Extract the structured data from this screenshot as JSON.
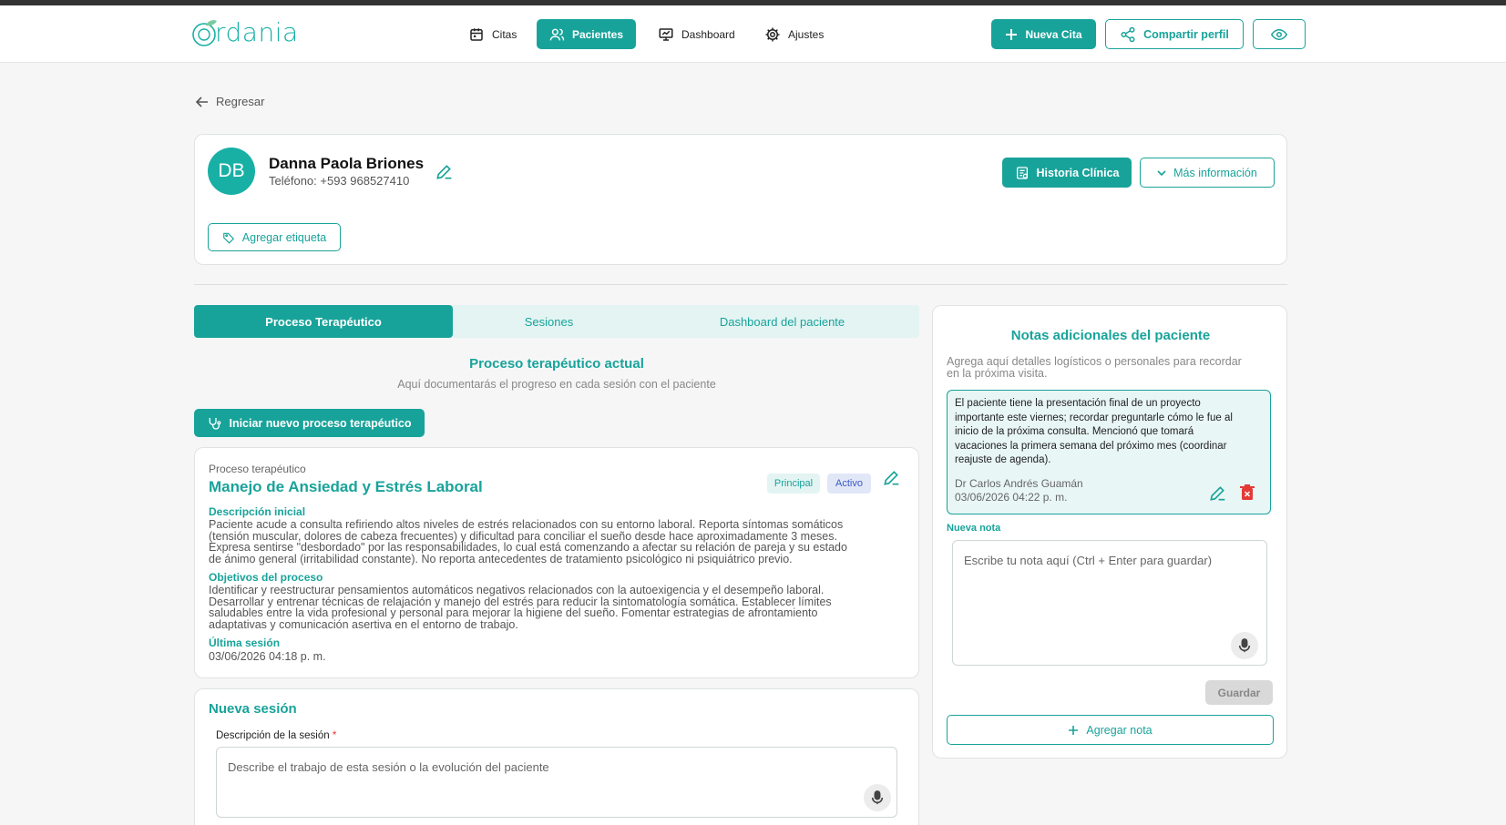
{
  "app": {
    "logo_text": "rdania"
  },
  "nav": {
    "citas": "Citas",
    "pacientes": "Pacientes",
    "dashboard": "Dashboard",
    "ajustes": "Ajustes",
    "nueva_cita": "Nueva Cita",
    "compartir_perfil": "Compartir perfil"
  },
  "back_label": "Regresar",
  "patient": {
    "initials": "DB",
    "name": "Danna Paola Briones",
    "phone": "Teléfono: +593 968527410",
    "historia_btn": "Historia Clínica",
    "mas_info_btn": "Más información",
    "tag_btn": "Agregar etiqueta"
  },
  "tabs": [
    "Proceso Terapéutico",
    "Sesiones",
    "Dashboard del paciente"
  ],
  "process_section": {
    "title": "Proceso terapéutico actual",
    "subtitle": "Aquí documentarás el progreso en cada sesión con el paciente",
    "new_btn": "Iniciar nuevo proceso terapéutico"
  },
  "process": {
    "kicker": "Proceso terapéutico",
    "title": "Manejo de Ansiedad y Estrés Laboral",
    "badge_principal": "Principal",
    "badge_activo": "Activo",
    "desc_label": "Descripción inicial",
    "desc_lines": [
      "Paciente acude a consulta refiriendo altos niveles de estrés relacionados con su entorno laboral. Reporta síntomas somáticos",
      "(tensión muscular, dolores de cabeza frecuentes) y dificultad para conciliar el sueño desde hace aproximadamente 3 meses.",
      "Expresa sentirse \"desbordado\" por las responsabilidades, lo cual está comenzando a afectar su relación de pareja y su estado",
      "de ánimo general (irritabilidad constante). No reporta antecedentes de tratamiento psicológico ni psiquiátrico previo."
    ],
    "goals_label": "Objetivos del proceso",
    "goals_lines": [
      "Identificar y reestructurar pensamientos automáticos negativos relacionados con la autoexigencia y el desempeño laboral.",
      "Desarrollar y entrenar técnicas de relajación y manejo del estrés para reducir la sintomatología somática. Establecer límites",
      "saludables entre la vida profesional y personal para mejorar la higiene del sueño. Fomentar estrategias de afrontamiento",
      "adaptativas y comunicación asertiva en el entorno de trabajo."
    ],
    "last_label": "Última sesión",
    "last_value": "03/06/2026 04:18 p. m."
  },
  "new_session": {
    "title": "Nueva sesión",
    "field_label": "Descripción de la sesión",
    "required_mark": "*",
    "placeholder": "Describe el trabajo de esta sesión o la evolución del paciente"
  },
  "notes": {
    "title": "Notas adicionales del paciente",
    "subtitle_lines": [
      "Agrega aquí detalles logísticos o personales para recordar",
      "en la próxima visita."
    ],
    "note_lines": [
      "El paciente tiene la presentación final de un proyecto",
      "importante este viernes; recordar preguntarle cómo le fue al",
      "inicio de la próxima consulta. Mencionó que tomará",
      "vacaciones la primera semana del próximo mes (coordinar",
      "reajuste de agenda)."
    ],
    "note_author": "Dr Carlos Andrés Guamán",
    "note_date": "03/06/2026 04:22 p. m.",
    "new_label": "Nueva nota",
    "placeholder": "Escribe tu nota aquí (Ctrl + Enter para guardar)",
    "save_btn": "Guardar",
    "add_btn": "Agregar nota"
  },
  "colors": {
    "accent": "#18a39a",
    "accent_light": "#e3f4f3",
    "danger": "#e53935"
  }
}
